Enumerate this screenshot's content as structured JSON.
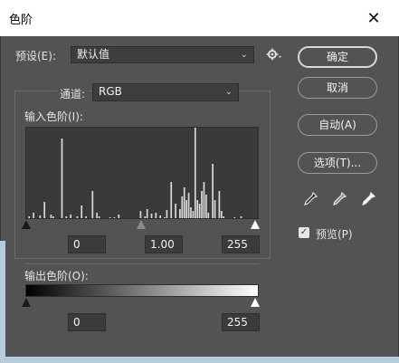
{
  "window": {
    "title": "色阶",
    "close_glyph": "✕"
  },
  "preset": {
    "label": "预设(E):",
    "value": "默认值"
  },
  "channel": {
    "label": "通道:",
    "value": "RGB"
  },
  "input_levels": {
    "label": "输入色阶(I):",
    "black": "0",
    "gamma": "1.00",
    "white": "255"
  },
  "output_levels": {
    "label": "输出色阶(O):",
    "black": "0",
    "white": "255"
  },
  "buttons": {
    "ok": "确定",
    "cancel": "取消",
    "auto": "自动(A)",
    "options": "选项(T)..."
  },
  "preview": {
    "label": "预览(P)",
    "checked": true
  },
  "icons": {
    "settings": "gear-icon",
    "eyedroppers": [
      "black-point-eyedropper-icon",
      "gray-point-eyedropper-icon",
      "white-point-eyedropper-icon"
    ]
  },
  "colors": {
    "dialog_bg": "#535353",
    "field_bg": "#3b3b3b",
    "histogram_bar": "#d9d9d9"
  },
  "histogram": {
    "bins": [
      0,
      2,
      0,
      6,
      0,
      0,
      3,
      0,
      18,
      0,
      0,
      4,
      2,
      0,
      0,
      0,
      88,
      0,
      2,
      0,
      4,
      0,
      0,
      2,
      0,
      14,
      0,
      2,
      0,
      0,
      30,
      0,
      6,
      2,
      0,
      0,
      0,
      0,
      1,
      0,
      1,
      0,
      4,
      0,
      0,
      0,
      0,
      0,
      0,
      0,
      0,
      0,
      8,
      0,
      2,
      10,
      0,
      5,
      0,
      6,
      0,
      3,
      0,
      1,
      9,
      0,
      40,
      0,
      16,
      0,
      10,
      24,
      34,
      20,
      28,
      12,
      8,
      100,
      20,
      16,
      30,
      40,
      26,
      6,
      0,
      60,
      20,
      0,
      30,
      8,
      2,
      0,
      0,
      0,
      0,
      1,
      0,
      0,
      2,
      0,
      0,
      0,
      0,
      0,
      0,
      0
    ]
  }
}
